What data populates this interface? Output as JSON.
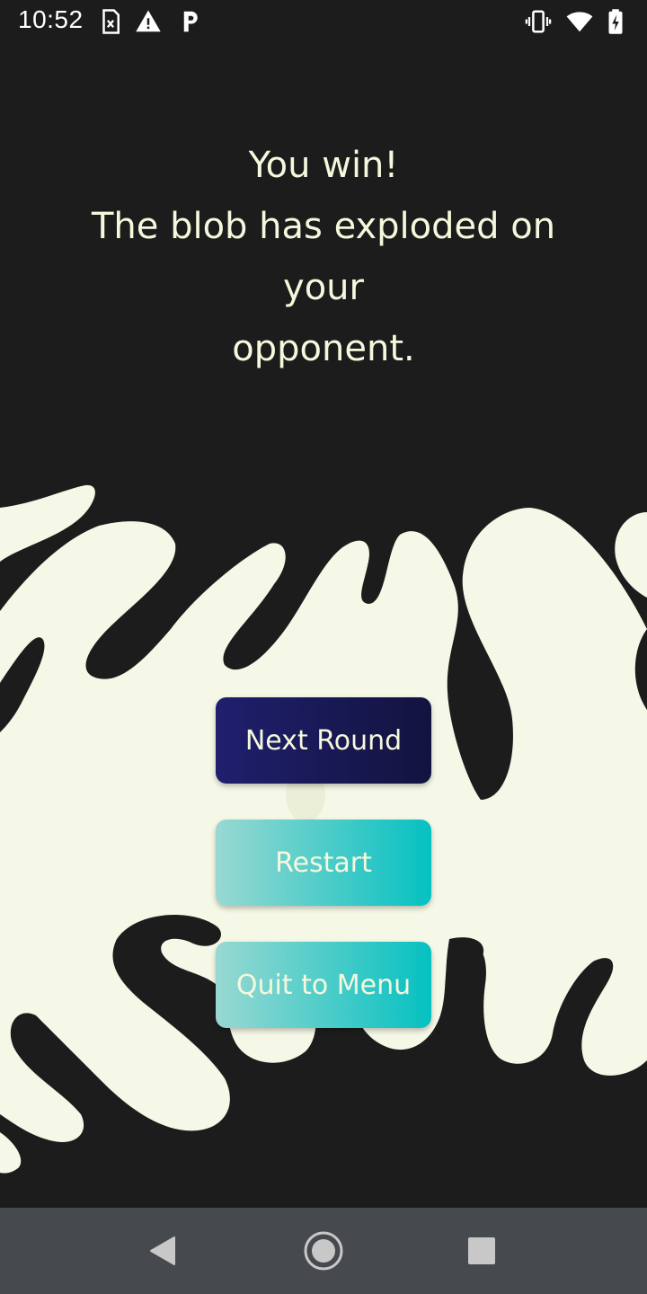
{
  "status_bar": {
    "time": "10:52",
    "icons": [
      "sim-card-icon",
      "warning-icon",
      "parking-icon",
      "vibrate-icon",
      "wifi-icon",
      "battery-charging-icon"
    ]
  },
  "message": {
    "line1": "You win!",
    "line2": "The blob has exploded on your",
    "line3": "opponent."
  },
  "buttons": {
    "next_round": "Next Round",
    "restart": "Restart",
    "quit": "Quit to Menu"
  },
  "colors": {
    "background": "#1c1c1c",
    "blob": "#f5f8e6",
    "text": "#f5f8dc",
    "next_round_gradient": [
      "#1f1f6e",
      "#13133f"
    ],
    "teal_gradient": [
      "#99d8d2",
      "#05c1c1"
    ],
    "nav_bar": "#464a4f"
  },
  "nav_bar": {
    "icons": [
      "back-icon",
      "home-icon",
      "recents-icon"
    ]
  }
}
